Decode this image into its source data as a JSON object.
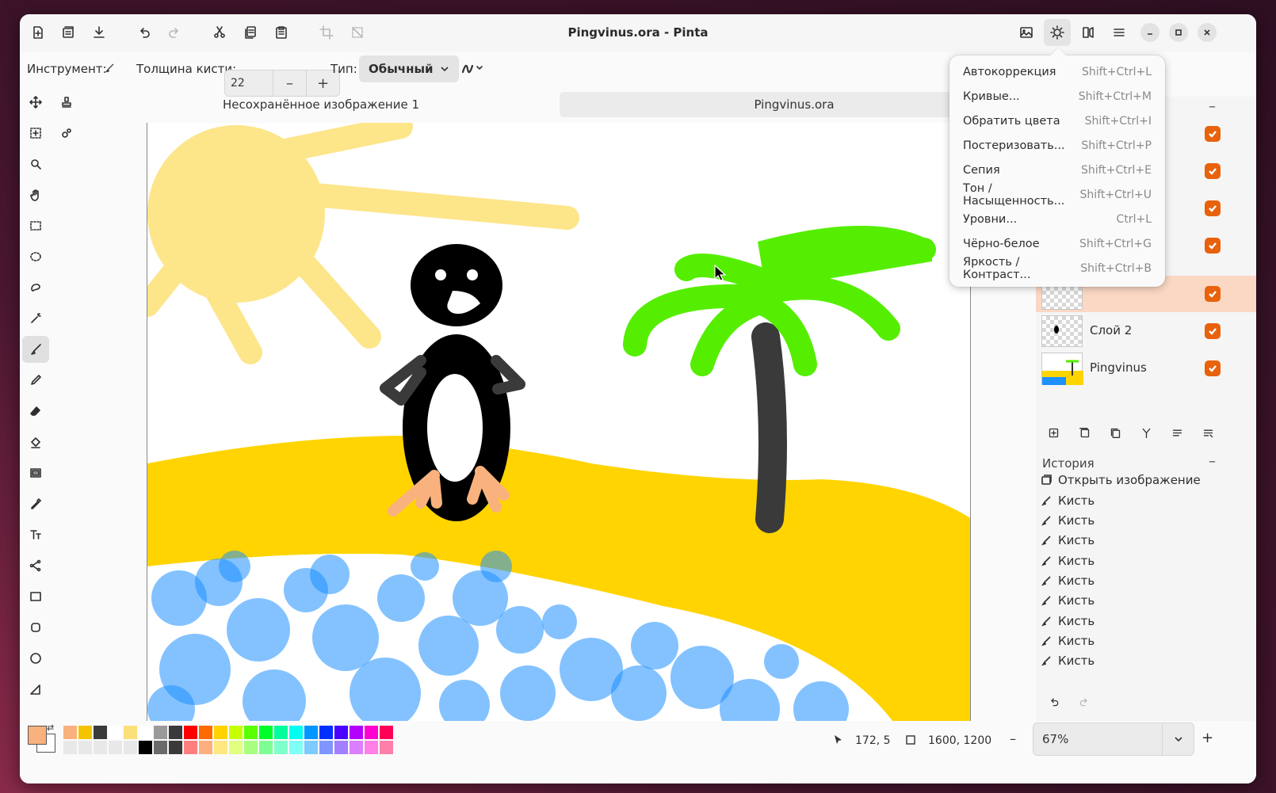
{
  "window": {
    "title": "Pingvinus.ora - Pinta"
  },
  "toolbar": {
    "tool_label": "Инструмент:",
    "brush_width_label": "Толщина кисти:",
    "brush_width_value": "22",
    "type_label": "Тип:",
    "type_value": "Обычный"
  },
  "tabs": [
    {
      "label": "Несохранённое изображение 1",
      "active": false
    },
    {
      "label": "Pingvinus.ora",
      "active": true
    }
  ],
  "adjustments_menu": [
    {
      "label": "Автокоррекция",
      "shortcut": "Shift+Ctrl+L"
    },
    {
      "label": "Кривые...",
      "shortcut": "Shift+Ctrl+M"
    },
    {
      "label": "Обратить цвета",
      "shortcut": "Shift+Ctrl+I"
    },
    {
      "label": "Постеризовать...",
      "shortcut": "Shift+Ctrl+P"
    },
    {
      "label": "Сепия",
      "shortcut": "Shift+Ctrl+E"
    },
    {
      "label": "Тон / Насыщенность...",
      "shortcut": "Shift+Ctrl+U"
    },
    {
      "label": "Уровни...",
      "shortcut": "Ctrl+L"
    },
    {
      "label": "Чёрно-белое",
      "shortcut": "Shift+Ctrl+G"
    },
    {
      "label": "Яркость / Контраст...",
      "shortcut": "Shift+Ctrl+B"
    }
  ],
  "layers": [
    {
      "name": "",
      "visible": true
    },
    {
      "name": "",
      "visible": true
    },
    {
      "name": "",
      "visible": true
    },
    {
      "name": "",
      "visible": true
    },
    {
      "name": "",
      "visible": true,
      "selected": true
    },
    {
      "name": "Слой 2",
      "visible": true
    },
    {
      "name": "Pingvinus",
      "visible": true
    }
  ],
  "history": {
    "title": "История",
    "items": [
      "Открыть изображение",
      "Кисть",
      "Кисть",
      "Кисть",
      "Кисть",
      "Кисть",
      "Кисть",
      "Кисть",
      "Кисть",
      "Кисть"
    ]
  },
  "status": {
    "cursor_pos": "172, 5",
    "image_size": "1600, 1200",
    "zoom": "67%"
  },
  "colors": {
    "primary": "#f9b27e",
    "secondary": "#ffffff",
    "accent": "#e8620d",
    "palette_top": [
      "#f9b27e",
      "#f5c400",
      "#3a3a3a",
      "#ffffff",
      "#fbe07a",
      "#ffffff",
      "#9a9a9a",
      "#3a3a3a",
      "#ff0000",
      "#ff6a00",
      "#ffd200",
      "#c8ff00",
      "#5aff00",
      "#00ff2a",
      "#00ff9c",
      "#00fff0",
      "#0096ff",
      "#0030ff",
      "#4a00ff",
      "#b400ff",
      "#ff00d0",
      "#ff0058"
    ],
    "palette_bottom": [
      "#e8e8e8",
      "#e8e8e8",
      "#e8e8e8",
      "#e8e8e8",
      "#e8e8e8",
      "#000000",
      "#6a6a6a",
      "#3a3a3a",
      "#ff7f7f",
      "#ffae7f",
      "#ffe87f",
      "#e0ff7f",
      "#a8ff7f",
      "#7fff93",
      "#7fffcc",
      "#7ffff6",
      "#7fcaff",
      "#7f96ff",
      "#a17fff",
      "#d97fff",
      "#ff7fe6",
      "#ff7fab"
    ]
  }
}
